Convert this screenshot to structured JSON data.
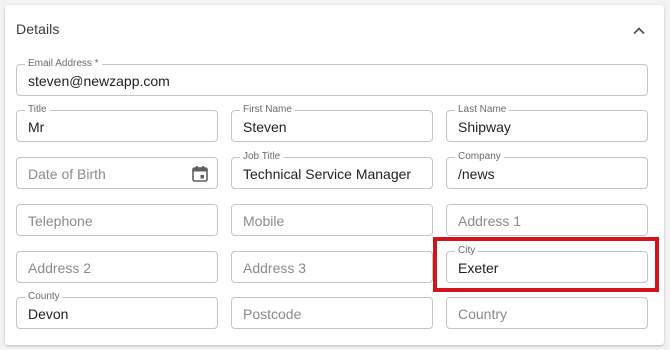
{
  "card": {
    "title": "Details"
  },
  "icons": {
    "collapse": "chevron-up-icon",
    "calendar": "calendar-icon"
  },
  "fields": {
    "email": {
      "label": "Email Address *",
      "value": "steven@newzapp.com"
    },
    "title": {
      "label": "Title",
      "value": "Mr"
    },
    "first_name": {
      "label": "First Name",
      "value": "Steven"
    },
    "last_name": {
      "label": "Last Name",
      "value": "Shipway"
    },
    "date_of_birth": {
      "placeholder": "Date of Birth"
    },
    "job_title": {
      "label": "Job Title",
      "value": "Technical Service Manager"
    },
    "company": {
      "label": "Company",
      "value": "/news"
    },
    "telephone": {
      "placeholder": "Telephone"
    },
    "mobile": {
      "placeholder": "Mobile"
    },
    "address1": {
      "placeholder": "Address 1"
    },
    "address2": {
      "placeholder": "Address 2"
    },
    "address3": {
      "placeholder": "Address 3"
    },
    "city": {
      "label": "City",
      "value": "Exeter"
    },
    "county": {
      "label": "County",
      "value": "Devon"
    },
    "postcode": {
      "placeholder": "Postcode"
    },
    "country": {
      "placeholder": "Country"
    }
  },
  "colors": {
    "highlight": "#d4141b"
  }
}
